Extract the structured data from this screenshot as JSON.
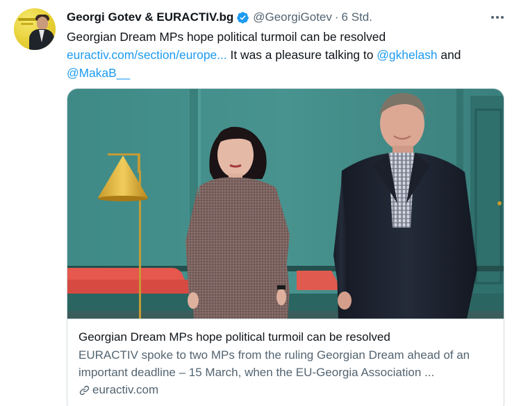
{
  "tweet": {
    "author_name": "Georgi Gotev & EURACTIV.bg",
    "author_handle": "@GeorgiGotev",
    "separator": "·",
    "timestamp": "6 Std.",
    "text_part1": "Georgian Dream MPs hope political turmoil can be resolved",
    "link_url": "euractiv.com/section/europe...",
    "text_part2": " It was a pleasure talking to ",
    "mention1": "@gkhelash",
    "text_part3": " and",
    "mention2": "@MakaB__"
  },
  "card": {
    "title": "Georgian Dream MPs hope political turmoil can be resolved",
    "description": "EURACTIV spoke to two MPs from the ruling Georgian Dream ahead of an important deadline – 15 March, when the EU-Georgia Association ...",
    "domain": "euractiv.com"
  },
  "icons": {
    "verified": "verified-badge-icon",
    "more": "more-options-icon",
    "link": "link-icon"
  },
  "colors": {
    "accent": "#1d9bf0",
    "secondary_text": "#536471",
    "border": "#cfd9de"
  }
}
